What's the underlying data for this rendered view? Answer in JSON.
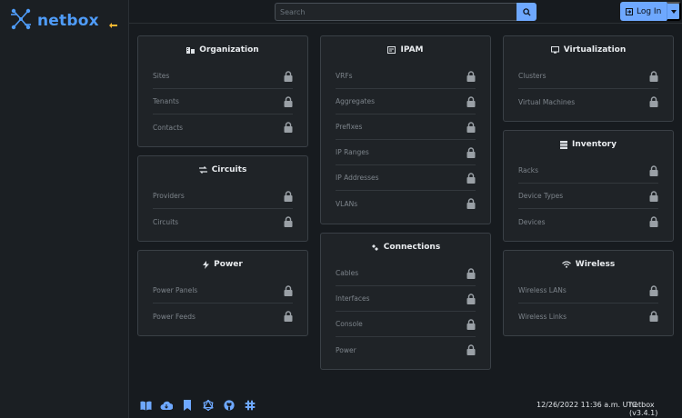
{
  "brand": {
    "name": "netbox"
  },
  "search": {
    "placeholder": "Search"
  },
  "login": {
    "label": "Log In"
  },
  "cards": {
    "organization": {
      "title": "Organization",
      "items": [
        "Sites",
        "Tenants",
        "Contacts"
      ]
    },
    "circuits": {
      "title": "Circuits",
      "items": [
        "Providers",
        "Circuits"
      ]
    },
    "power": {
      "title": "Power",
      "items": [
        "Power Panels",
        "Power Feeds"
      ]
    },
    "ipam": {
      "title": "IPAM",
      "items": [
        "VRFs",
        "Aggregates",
        "Prefixes",
        "IP Ranges",
        "IP Addresses",
        "VLANs"
      ]
    },
    "connections": {
      "title": "Connections",
      "items": [
        "Cables",
        "Interfaces",
        "Console",
        "Power"
      ]
    },
    "virtualization": {
      "title": "Virtualization",
      "items": [
        "Clusters",
        "Virtual Machines"
      ]
    },
    "inventory": {
      "title": "Inventory",
      "items": [
        "Racks",
        "Device Types",
        "Devices"
      ]
    },
    "wireless": {
      "title": "Wireless",
      "items": [
        "Wireless LANs",
        "Wireless Links"
      ]
    }
  },
  "footer": {
    "timestamp": "12/26/2022 11:36 a.m. UTC",
    "version": "netbox (v3.4.1)",
    "icons": [
      "docs-icon",
      "api-icon",
      "bookmark-icon",
      "graphql-icon",
      "github-icon",
      "slack-icon"
    ]
  },
  "colors": {
    "accent": "#6ea8fe",
    "brand": "#4f9cf9",
    "background": "#171b1f",
    "card": "#1f2327"
  }
}
